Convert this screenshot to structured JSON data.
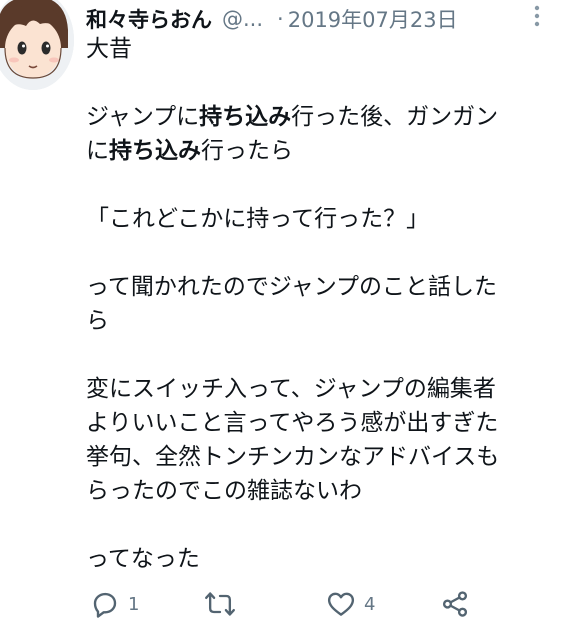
{
  "tweet": {
    "display_name": "和々寺らおん",
    "handle": "@...",
    "separator": "·",
    "date": "2019年07月23日",
    "body": {
      "line1": "大昔",
      "line2a_1": "ジャンプに",
      "line2a_bold": "持ち込み",
      "line2a_2": "行った後、ガンガン",
      "line2b_1": "に",
      "line2b_bold": "持ち込み",
      "line2b_2": "行ったら",
      "line3": "「これどこかに持って行った？」",
      "line4a": "って聞かれたのでジャンプのこと話した",
      "line4b": "ら",
      "line5a": "変にスイッチ入って、ジャンプの編集者",
      "line5b": "よりいいこと言ってやろう感が出すぎた",
      "line5c": "挙句、全然トンチンカンなアドバイスも",
      "line5d": "らったのでこの雑誌ないわ",
      "line6": "ってなった"
    },
    "actions": {
      "reply_count": "1",
      "retweet_count": "",
      "like_count": "4"
    }
  },
  "icons": {
    "avatar": "avatar-illustration",
    "more": "more-vertical-icon",
    "reply": "reply-icon",
    "retweet": "retweet-icon",
    "like": "heart-icon",
    "share": "share-icon"
  },
  "colors": {
    "text": "#0f1419",
    "secondary": "#657786",
    "icon": "#536471"
  }
}
